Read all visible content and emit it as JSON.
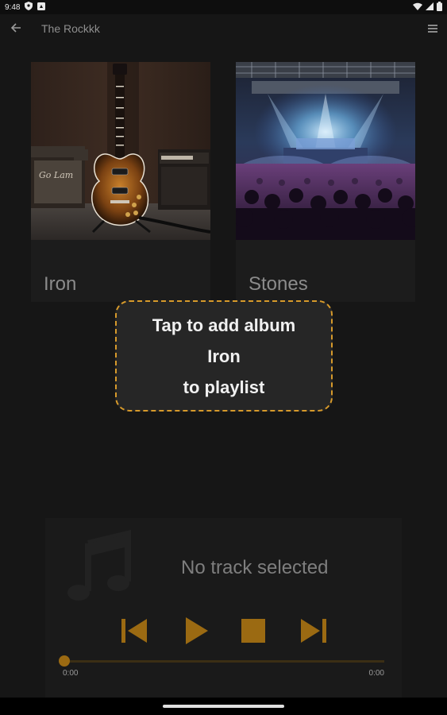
{
  "status_bar": {
    "time": "9:48",
    "icons": [
      "shield-icon",
      "notification-icon",
      "wifi-icon",
      "signal-icon",
      "battery-icon"
    ]
  },
  "app_bar": {
    "title": "The Rockkk",
    "back_icon": "arrow-back-icon",
    "menu_icon": "menu-icon"
  },
  "albums": [
    {
      "name": "Iron",
      "art": "electric guitar with amplifiers"
    },
    {
      "name": "Stones",
      "art": "concert stage with crowd"
    }
  ],
  "tooltip": {
    "line1": "Tap to add album",
    "line2": "Iron",
    "line3": "to playlist"
  },
  "player": {
    "status": "No track selected",
    "time_start": "0:00",
    "time_end": "0:00",
    "progress": 0,
    "controls": [
      "skip-previous-icon",
      "play-icon",
      "stop-icon",
      "skip-next-icon"
    ]
  },
  "colors": {
    "background": "#161616",
    "accent": "#d79a2b",
    "controls": "#9b6a12"
  }
}
